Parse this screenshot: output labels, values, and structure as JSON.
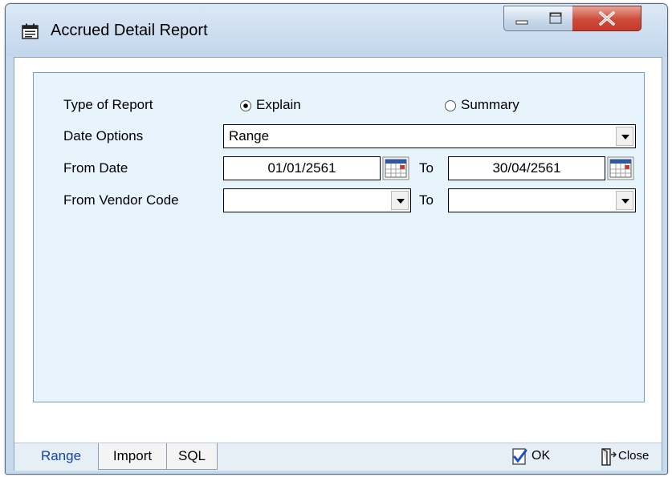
{
  "window": {
    "title": "Accrued Detail Report"
  },
  "form": {
    "type_label": "Type of Report",
    "type_options": [
      {
        "label": "Explain",
        "selected": true
      },
      {
        "label": "Summary",
        "selected": false
      }
    ],
    "date_options_label": "Date Options",
    "date_options_value": "Range",
    "from_date_label": "From Date",
    "from_date_value": "01/01/2561",
    "to_label": "To",
    "to_date_value": "30/04/2561",
    "vendor_label": "From Vendor Code",
    "vendor_from_value": "",
    "vendor_to_label": "To",
    "vendor_to_value": ""
  },
  "tabs": [
    {
      "label": "Range",
      "active": true
    },
    {
      "label": "Import",
      "active": false
    },
    {
      "label": "SQL",
      "active": false
    }
  ],
  "actions": {
    "ok_label": "OK",
    "close_label": "Close"
  },
  "icons": {
    "title": "report-window-icon",
    "calendar": "calendar-icon",
    "ok": "check-document-icon",
    "close": "exit-door-icon"
  },
  "colors": {
    "panel_bg": "#e7f4fc",
    "active_tab_text": "#1144aa",
    "close_button": "#c53a2a"
  }
}
